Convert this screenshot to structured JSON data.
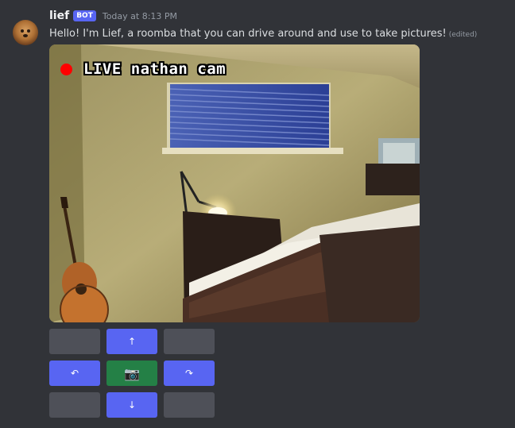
{
  "author": {
    "username": "lief",
    "tag": "BOT",
    "timestamp": "Today at 8:13 PM"
  },
  "message": {
    "text": "Hello! I'm Lief, a roomba that you can drive around and use to take pictures!",
    "edited_label": "(edited)"
  },
  "camera": {
    "overlay_text": "LIVE nathan cam",
    "live_color": "#ff0000"
  },
  "controls": {
    "rows": [
      [
        {
          "label": "",
          "style": "secondary"
        },
        {
          "label": "↑",
          "style": "primary"
        },
        {
          "label": "",
          "style": "secondary"
        }
      ],
      [
        {
          "label": "↶",
          "style": "primary"
        },
        {
          "label": "📷",
          "style": "success"
        },
        {
          "label": "↷",
          "style": "primary"
        }
      ],
      [
        {
          "label": "",
          "style": "secondary"
        },
        {
          "label": "↓",
          "style": "primary"
        },
        {
          "label": "",
          "style": "secondary"
        }
      ]
    ]
  },
  "colors": {
    "background": "#313338",
    "primary": "#5865f2",
    "success": "#248046",
    "secondary": "#4e5058"
  }
}
